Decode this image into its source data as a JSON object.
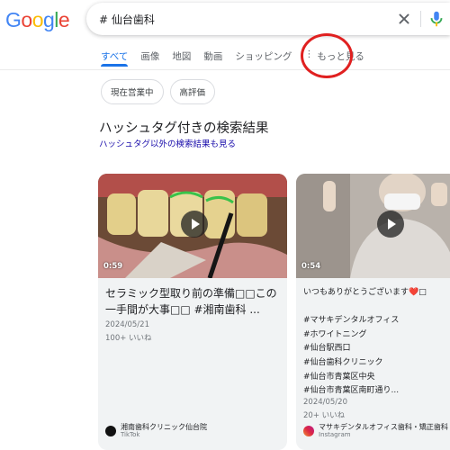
{
  "logo": {
    "text": "Google",
    "letters": [
      "G",
      "o",
      "o",
      "g",
      "l",
      "e"
    ],
    "colors": [
      "#4285f4",
      "#ea4335",
      "#fbbc05",
      "#4285f4",
      "#34a853",
      "#ea4335"
    ]
  },
  "search": {
    "query": "# 仙台歯科"
  },
  "tabs": [
    {
      "label": "すべて",
      "active": true
    },
    {
      "label": "画像"
    },
    {
      "label": "地図"
    },
    {
      "label": "動画"
    },
    {
      "label": "ショッピング"
    },
    {
      "label": "もっと見る"
    }
  ],
  "chips": [
    "現在営業中",
    "高評価"
  ],
  "section": {
    "heading": "ハッシュタグ付きの検索結果",
    "link": "ハッシュタグ以外の検索結果も見る"
  },
  "cards": [
    {
      "duration": "0:59",
      "title": "セラミック型取り前の準備□□この一手間が大事□□ #湘南歯科 ...",
      "date": "2024/05/21",
      "likes": "100+ いいね",
      "source_name": "湘南歯科クリニック仙台院",
      "platform": "TikTok"
    },
    {
      "duration": "0:54",
      "lines": [
        "いつもありがとうございます❤️□",
        "",
        "#マサキデンタルオフィス",
        "#ホワイトニング",
        "#仙台駅西口",
        "#仙台歯科クリニック",
        "#仙台市青葉区中央",
        "#仙台市青葉区南町通り..."
      ],
      "date": "2024/05/20",
      "likes": "20+ いいね",
      "source_name": "マサキデンタルオフィス歯科・矯正歯科",
      "platform": "Instagram"
    }
  ],
  "colors": {
    "accent": "#1a73e8",
    "link": "#1a0dab",
    "highlight_circle": "#e02020"
  }
}
